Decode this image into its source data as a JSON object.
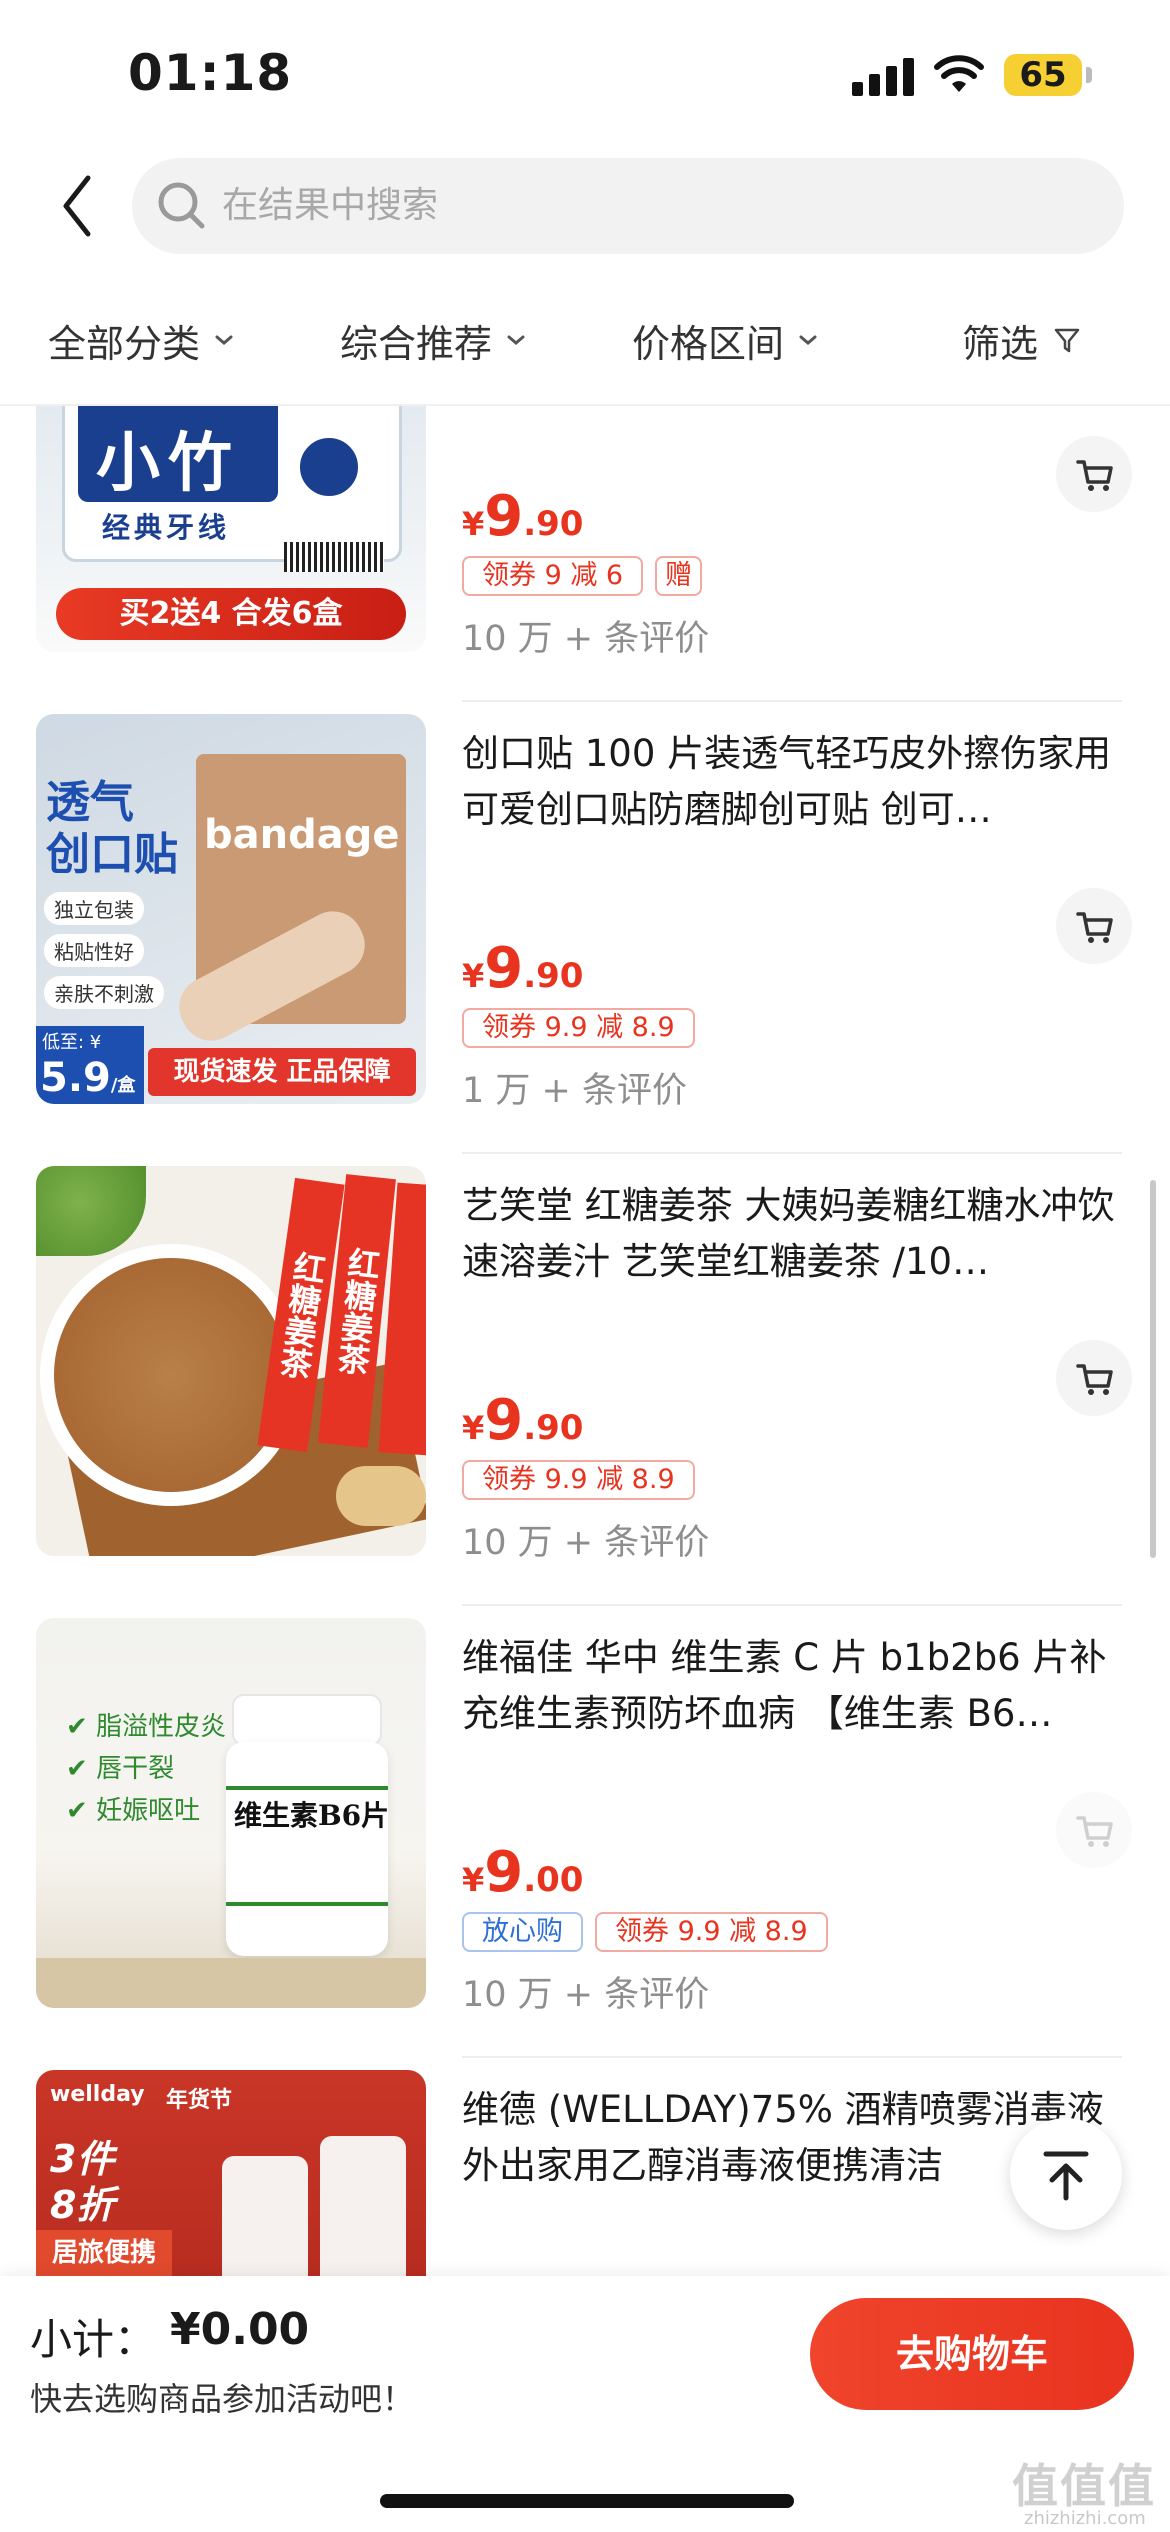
{
  "status_bar": {
    "time": "01:18",
    "battery": "65"
  },
  "header": {
    "search_placeholder": "在结果中搜索"
  },
  "filters": [
    {
      "label": "全部分类"
    },
    {
      "label": "综合推荐"
    },
    {
      "label": "价格区间"
    },
    {
      "label": "筛选"
    }
  ],
  "products": [
    {
      "title": "",
      "image_text": {
        "brand": "小竹",
        "sub": "经典牙线",
        "banner": "买2送4 合发6盒"
      },
      "price": {
        "currency": "¥",
        "int": "9",
        "dec": ".90"
      },
      "tags": [
        "领券 9 减 6",
        "赠"
      ],
      "reviews": "10 万 + 条评价"
    },
    {
      "title": "创口贴 100 片装透气轻巧皮外擦伤家用可爱创口贴防磨脚创可贴 创可…",
      "image_text": {
        "headline1": "透气",
        "headline2": "创口贴",
        "box": "bandage",
        "bullet1": "独立包装",
        "bullet2": "粘贴性好",
        "bullet3": "亲肤不刺激",
        "low": "低至: ¥",
        "low_price": "5.9",
        "unit": "/盒",
        "banner": "现货速发 正品保障"
      },
      "price": {
        "currency": "¥",
        "int": "9",
        "dec": ".90"
      },
      "tags": [
        "领券 9.9 减 8.9"
      ],
      "reviews": "1 万 + 条评价"
    },
    {
      "title": "艺笑堂 红糖姜茶 大姨妈姜糖红糖水冲饮速溶姜汁 艺笑堂红糖姜茶 /10…",
      "image_text": {
        "sachet": "红糖姜茶"
      },
      "price": {
        "currency": "¥",
        "int": "9",
        "dec": ".90"
      },
      "tags": [
        "领券 9.9 减 8.9"
      ],
      "reviews": "10 万 + 条评价"
    },
    {
      "title": "维福佳 华中 维生素 C 片 b1b2b6 片补充维生素预防坏血病 【维生素 B6…",
      "image_text": {
        "bullet1": "脂溢性皮炎",
        "bullet2": "唇干裂",
        "bullet3": "妊娠呕吐",
        "label": "维生素B6片"
      },
      "price": {
        "currency": "¥",
        "int": "9",
        "dec": ".00"
      },
      "tags": [
        "放心购",
        "领券 9.9 减 8.9"
      ],
      "reviews": "10 万 + 条评价"
    },
    {
      "title": "维德 (WELLDAY)75% 酒精喷雾消毒液外出家用乙醇消毒液便携清洁",
      "image_text": {
        "brand": "wellday",
        "festival": "年货节",
        "promo1": "3件",
        "promo2": "8折",
        "banner": "居旅便携"
      },
      "price": {
        "currency": "",
        "int": "",
        "dec": ""
      },
      "tags": [],
      "reviews": ""
    }
  ],
  "bottom_bar": {
    "subtotal_label": "小计：",
    "subtotal_value": "¥0.00",
    "hint": "快去选购商品参加活动吧！",
    "checkout": "去购物车"
  },
  "watermark": {
    "main": "值值值",
    "sub": "zhizhizhi.com"
  },
  "colors": {
    "accent": "#e8331f",
    "tag_border": "#f2a9a0",
    "blue_tag": "#2f6fd6"
  }
}
